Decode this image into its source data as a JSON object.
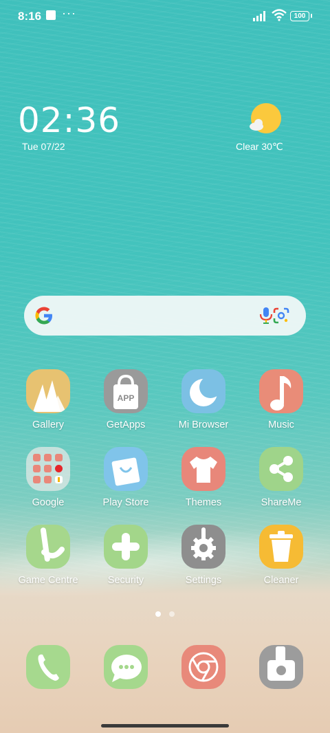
{
  "status_bar": {
    "time": "8:16",
    "more": "···",
    "battery": "100"
  },
  "clock_widget": {
    "time": "02:36",
    "date": "Tue 07/22"
  },
  "weather_widget": {
    "condition_temp": "Clear  30℃"
  },
  "search_bar": {},
  "apps": [
    {
      "label": "Gallery",
      "color": "#e7c271"
    },
    {
      "label": "GetApps",
      "color": "#9a9a9a"
    },
    {
      "label": "Mi Browser",
      "color": "#7cc0e4"
    },
    {
      "label": "Music",
      "color": "#e98c78"
    },
    {
      "label": "Google",
      "color": "#dde7e6"
    },
    {
      "label": "Play Store",
      "color": "#80c4ea"
    },
    {
      "label": "Themes",
      "color": "#e8877a"
    },
    {
      "label": "ShareMe",
      "color": "#9fd48a"
    },
    {
      "label": "Game Centre",
      "color": "#a6d78c"
    },
    {
      "label": "Security",
      "color": "#a3d68a"
    },
    {
      "label": "Settings",
      "color": "#8e8e8e"
    },
    {
      "label": "Cleaner",
      "color": "#f6bb34"
    }
  ],
  "dock": [
    {
      "name": "phone",
      "color": "#a6d98e"
    },
    {
      "name": "messaging",
      "color": "#a5d88d"
    },
    {
      "name": "chrome",
      "color": "#e8897a"
    },
    {
      "name": "camera",
      "color": "#9c9c9c"
    }
  ]
}
